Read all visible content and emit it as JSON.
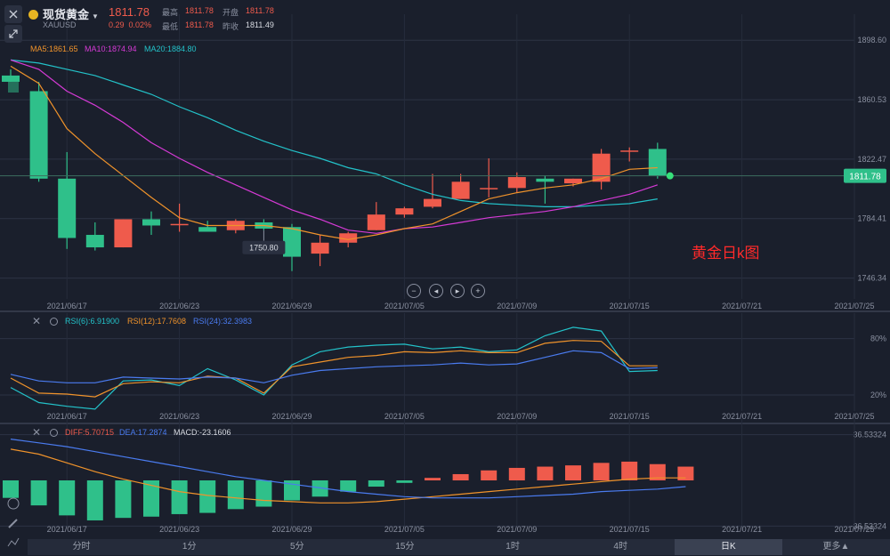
{
  "header": {
    "title": "现货黄金",
    "symbol": "XAUUSD",
    "price": "1811.78",
    "change": "0.29",
    "change_pct": "0.02%",
    "high_label": "最高",
    "high": "1811.78",
    "open_label": "开盘",
    "open": "1811.78",
    "low_label": "最低",
    "low": "1811.78",
    "prev_close_label": "昨收",
    "prev_close": "1811.49"
  },
  "colors": {
    "up": "#ef5b4c",
    "down": "#2fc08a",
    "ma5": "#f0932b",
    "ma10": "#d63ad6",
    "ma20": "#23c2c9",
    "rsi6": "#23c2c9",
    "rsi12": "#f0932b",
    "rsi24": "#4a7bef",
    "diff": "#f0932b",
    "dea": "#4a7bef"
  },
  "annotation": "黄金日k图",
  "controls": [
    {
      "name": "zoom-out-icon",
      "glyph": "−"
    },
    {
      "name": "scroll-left-icon",
      "glyph": "◂"
    },
    {
      "name": "scroll-right-icon",
      "glyph": "▸"
    },
    {
      "name": "zoom-in-icon",
      "glyph": "+"
    }
  ],
  "chart_data": [
    {
      "type": "candlestick",
      "legend": [
        {
          "label": "MA5:1861.65",
          "color": "#f0932b"
        },
        {
          "label": "MA10:1874.94",
          "color": "#d63ad6"
        },
        {
          "label": "MA20:1884.80",
          "color": "#23c2c9"
        }
      ],
      "y_ticks": [
        "1898.60",
        "1860.53",
        "1822.47",
        "1784.41",
        "1746.34"
      ],
      "y_tick_values": [
        1898.6,
        1860.53,
        1822.47,
        1784.41,
        1746.34
      ],
      "ylim": [
        1733,
        1905
      ],
      "x_ticks": [
        {
          "label": "2021/06/17",
          "i": 0
        },
        {
          "label": "2021/06/23",
          "i": 4
        },
        {
          "label": "2021/06/29",
          "i": 8
        },
        {
          "label": "2021/07/05",
          "i": 12
        },
        {
          "label": "2021/07/09",
          "i": 16
        },
        {
          "label": "2021/07/15",
          "i": 20
        },
        {
          "label": "2021/07/21",
          "i": 24
        },
        {
          "label": "2021/07/25",
          "i": 28
        }
      ],
      "current_price_tag": "1811.78",
      "current_price": 1811.78,
      "low_marker": "1750.80",
      "low_marker_i": 9,
      "candles": [
        {
          "o": 1876,
          "h": 1880,
          "l": 1872,
          "c": 1872
        },
        {
          "o": 1866,
          "h": 1872,
          "l": 1808,
          "c": 1810
        },
        {
          "o": 1810,
          "h": 1827,
          "l": 1765,
          "c": 1772
        },
        {
          "o": 1774,
          "h": 1782,
          "l": 1764,
          "c": 1766
        },
        {
          "o": 1766,
          "h": 1784,
          "l": 1766,
          "c": 1784
        },
        {
          "o": 1784,
          "h": 1789,
          "l": 1774,
          "c": 1780
        },
        {
          "o": 1781,
          "h": 1794,
          "l": 1776,
          "c": 1781
        },
        {
          "o": 1779,
          "h": 1783,
          "l": 1776,
          "c": 1776
        },
        {
          "o": 1777,
          "h": 1784,
          "l": 1775,
          "c": 1783
        },
        {
          "o": 1782,
          "h": 1784,
          "l": 1777,
          "c": 1778
        },
        {
          "o": 1779,
          "h": 1781,
          "l": 1750.8,
          "c": 1760
        },
        {
          "o": 1762,
          "h": 1774,
          "l": 1754,
          "c": 1769
        },
        {
          "o": 1769,
          "h": 1776,
          "l": 1766,
          "c": 1775
        },
        {
          "o": 1777,
          "h": 1795,
          "l": 1777,
          "c": 1787
        },
        {
          "o": 1787,
          "h": 1792,
          "l": 1785,
          "c": 1791
        },
        {
          "o": 1792,
          "h": 1813,
          "l": 1791,
          "c": 1797
        },
        {
          "o": 1797,
          "h": 1813,
          "l": 1797,
          "c": 1808
        },
        {
          "o": 1804,
          "h": 1823,
          "l": 1798,
          "c": 1804
        },
        {
          "o": 1804,
          "h": 1814,
          "l": 1801,
          "c": 1811
        },
        {
          "o": 1810,
          "h": 1812,
          "l": 1794,
          "c": 1808
        },
        {
          "o": 1807,
          "h": 1810,
          "l": 1805,
          "c": 1810
        },
        {
          "o": 1808,
          "h": 1829,
          "l": 1803,
          "c": 1826
        },
        {
          "o": 1828,
          "h": 1830,
          "l": 1821,
          "c": 1828
        },
        {
          "o": 1829,
          "h": 1833,
          "l": 1810,
          "c": 1811.78
        }
      ],
      "ma5": [
        1882,
        1871,
        1842,
        1826,
        1812,
        1798,
        1785,
        1780,
        1780,
        1780,
        1778,
        1774,
        1771,
        1774,
        1778,
        1781,
        1789,
        1797,
        1801,
        1804,
        1806,
        1810,
        1816,
        1817
      ],
      "ma10": [
        1886,
        1880,
        1866,
        1857,
        1846,
        1833,
        1823,
        1814,
        1806,
        1798,
        1790,
        1784,
        1777,
        1775,
        1778,
        1779,
        1782,
        1785,
        1787,
        1789,
        1792,
        1796,
        1800,
        1806
      ],
      "ma20": [
        1886,
        1884,
        1880,
        1876,
        1870,
        1864,
        1856,
        1849,
        1841,
        1834,
        1828,
        1823,
        1817,
        1813,
        1806,
        1800,
        1796,
        1794,
        1793,
        1792,
        1792,
        1793,
        1794,
        1797
      ]
    },
    {
      "type": "line",
      "legend": [
        {
          "label": "RSI(6):6.91900",
          "color": "#23c2c9"
        },
        {
          "label": "RSI(12):17.7608",
          "color": "#f0932b"
        },
        {
          "label": "RSI(24):32.3983",
          "color": "#4a7bef"
        }
      ],
      "y_ticks": [
        "80%",
        "20%"
      ],
      "y_tick_values": [
        80,
        20
      ],
      "ylim": [
        3,
        90
      ],
      "x_ticks": [
        {
          "label": "2021/06/17",
          "i": 0
        },
        {
          "label": "2021/06/23",
          "i": 4
        },
        {
          "label": "2021/06/29",
          "i": 8
        },
        {
          "label": "2021/07/05",
          "i": 12
        },
        {
          "label": "2021/07/09",
          "i": 16
        },
        {
          "label": "2021/07/15",
          "i": 20
        },
        {
          "label": "2021/07/21",
          "i": 24
        },
        {
          "label": "2021/07/25",
          "i": 28
        }
      ],
      "series": [
        {
          "name": "RSI(6)",
          "color": "#23c2c9",
          "values": [
            28,
            12,
            8,
            5,
            35,
            36,
            30,
            48,
            36,
            20,
            52,
            66,
            71,
            73,
            74,
            69,
            71,
            66,
            68,
            83,
            92,
            88,
            45,
            46
          ]
        },
        {
          "name": "RSI(12)",
          "color": "#f0932b",
          "values": [
            38,
            22,
            21,
            18,
            32,
            34,
            33,
            40,
            38,
            22,
            50,
            55,
            60,
            62,
            66,
            65,
            67,
            65,
            65,
            75,
            78,
            77,
            51,
            51
          ]
        },
        {
          "name": "RSI(24)",
          "color": "#4a7bef",
          "values": [
            42,
            35,
            33,
            33,
            39,
            38,
            37,
            39,
            38,
            33,
            41,
            46,
            48,
            50,
            51,
            52,
            54,
            52,
            53,
            60,
            67,
            65,
            48,
            49
          ]
        }
      ]
    },
    {
      "type": "bar+line",
      "legend": [
        {
          "label": "DIFF:5.70715",
          "color": "#ef5b4c"
        },
        {
          "label": "DEA:17.2874",
          "color": "#4a7bef"
        },
        {
          "label": "MACD:-23.1606",
          "color": "#d8dbe2"
        }
      ],
      "y_ticks": [
        "36.53324",
        "-36.53324"
      ],
      "y_tick_values": [
        36.53324,
        -36.53324
      ],
      "ylim": [
        -37,
        37
      ],
      "x_ticks": [
        {
          "label": "2021/06/17",
          "i": 0
        },
        {
          "label": "2021/06/23",
          "i": 4
        },
        {
          "label": "2021/06/29",
          "i": 8
        },
        {
          "label": "2021/07/05",
          "i": 12
        },
        {
          "label": "2021/07/09",
          "i": 16
        },
        {
          "label": "2021/07/15",
          "i": 20
        },
        {
          "label": "2021/07/21",
          "i": 24
        },
        {
          "label": "2021/07/25",
          "i": 28
        }
      ],
      "macd_bars": [
        -14,
        -20,
        -28,
        -32,
        -30,
        -29,
        -27,
        -26,
        -23,
        -21,
        -16,
        -13,
        -9,
        -5,
        -2,
        2,
        5,
        8,
        10,
        11,
        12,
        14,
        15,
        13,
        11
      ],
      "diff": [
        25,
        21,
        14,
        7,
        1,
        -4,
        -9,
        -12,
        -14,
        -16,
        -17,
        -18,
        -18,
        -17,
        -15,
        -13,
        -11,
        -9,
        -7,
        -5,
        -3,
        -1,
        1,
        2,
        2
      ],
      "dea": [
        33,
        30,
        27,
        23,
        19,
        15,
        11,
        7,
        3,
        0,
        -3,
        -6,
        -9,
        -11,
        -13,
        -14,
        -14,
        -14,
        -13,
        -12,
        -11,
        -9,
        -8,
        -7,
        -5
      ]
    }
  ],
  "tabs": [
    "分时",
    "1分",
    "5分",
    "15分",
    "1时",
    "4时",
    "日K",
    "更多▲"
  ],
  "active_tab": 6
}
